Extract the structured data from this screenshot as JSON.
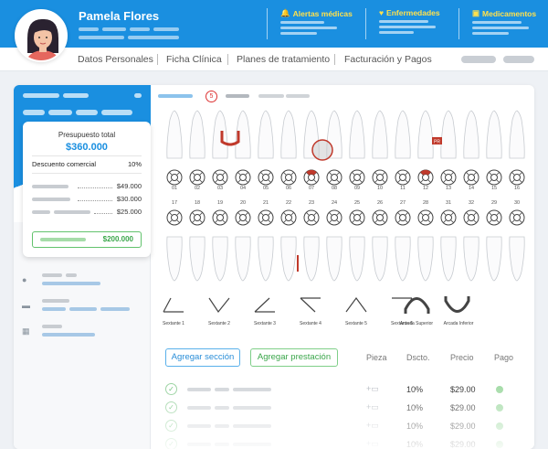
{
  "patient": {
    "name": "Pamela Flores"
  },
  "alerts": [
    {
      "label": "Alertas médicas",
      "icon": "bell-icon"
    },
    {
      "label": "Enfermedades",
      "icon": "heart-icon"
    },
    {
      "label": "Medicamentos",
      "icon": "medical-kit-icon"
    }
  ],
  "nav": {
    "items": [
      "Datos Personales",
      "Ficha Clínica",
      "Planes de tratamiento",
      "Facturación y Pagos"
    ]
  },
  "budget": {
    "title": "Presupuesto total",
    "total": "$360.000",
    "discount_label": "Descuento comercial",
    "discount_value": "10%",
    "lines": [
      "$49.000",
      "$30.000",
      "$25.000"
    ],
    "final": "$200.000"
  },
  "odontogram": {
    "tab_badge": "5",
    "upper_numbers": [
      "01",
      "02",
      "03",
      "04",
      "05",
      "06",
      "07",
      "08",
      "09",
      "10",
      "11",
      "12",
      "13",
      "14"
    ],
    "lower_numbers": [
      "17",
      "18",
      "19",
      "20",
      "21",
      "22",
      "23",
      "24",
      "25",
      "26",
      "27",
      "28",
      "31",
      "32"
    ],
    "sextants": [
      "Sextante 1",
      "Sextante 2",
      "Sextante 3",
      "Sextante 4",
      "Sextante 5",
      "Sextante 6",
      "Arcada Superior",
      "Arcada Inferior"
    ],
    "marker_pr": "PR"
  },
  "actions": {
    "add_section": "Agregar sección",
    "add_service": "Agregar prestación"
  },
  "table": {
    "headers": {
      "pieza": "Pieza",
      "dscto": "Dscto.",
      "precio": "Precio",
      "pago": "Pago"
    },
    "rows": [
      {
        "discount": "10%",
        "price": "$29.00"
      },
      {
        "discount": "10%",
        "price": "$29.00"
      },
      {
        "discount": "10%",
        "price": "$29.00"
      },
      {
        "discount": "10%",
        "price": "$29.00"
      }
    ]
  },
  "colors": {
    "primary": "#1a8fe0",
    "alert": "#ffe14d",
    "success": "#3aa64a",
    "danger": "#d33"
  }
}
